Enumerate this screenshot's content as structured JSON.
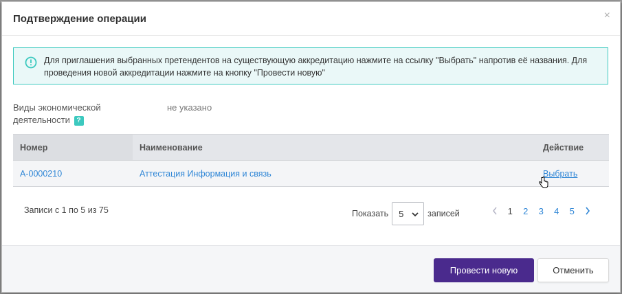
{
  "modal": {
    "title": "Подтверждение операции",
    "close_symbol": "×"
  },
  "alert": {
    "icon": "info-circle-icon",
    "text": "Для приглашения выбранных претендентов на существующую аккредитацию нажмите на ссылку \"Выбрать\" напротив её названия. Для проведения новой аккредитации нажмите на кнопку \"Провести новую\""
  },
  "field": {
    "label": "Виды экономической деятельности",
    "help_symbol": "?",
    "value": "не указано"
  },
  "table": {
    "headers": [
      "Номер",
      "Наименование",
      "Действие"
    ],
    "rows": [
      {
        "number": "А-0000210",
        "name": "Аттестация Информация и связь",
        "action": "Выбрать"
      }
    ]
  },
  "pagination": {
    "records_info": "Записи с 1 по 5 из 75",
    "show_label": "Показать",
    "page_size": "5",
    "records_label": "записей",
    "pages": [
      "1",
      "2",
      "3",
      "4",
      "5"
    ],
    "current_page": "1"
  },
  "footer": {
    "primary_label": "Провести новую",
    "secondary_label": "Отменить"
  },
  "colors": {
    "accent": "#4a2a8d",
    "alert_border": "#3cc9bf",
    "link": "#2f86d6"
  }
}
